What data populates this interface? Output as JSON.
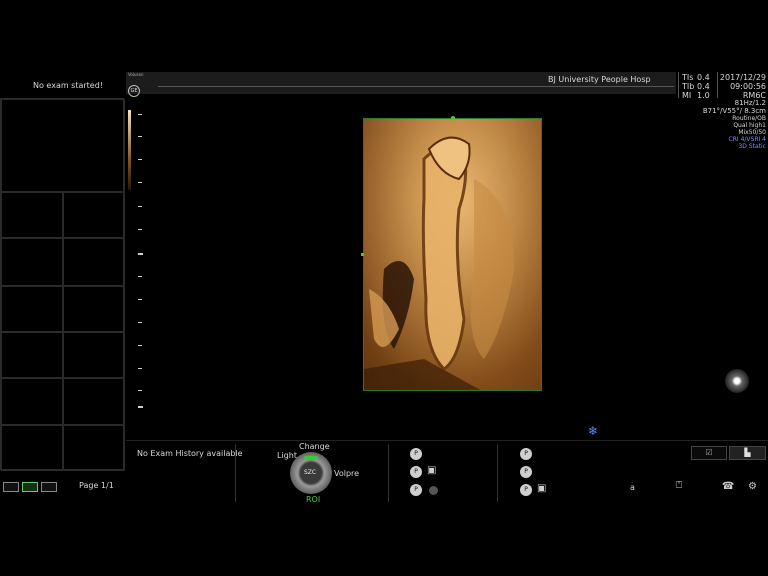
{
  "left_panel": {
    "status": "No exam started!",
    "history": "No Exam History available",
    "page": "Page 1/1"
  },
  "header": {
    "logo_small": "Voluson",
    "hospital": "BJ University People Hosp",
    "tis": "TIs",
    "tis_value": "0.4",
    "tib": "TIb",
    "tib_value": "0.4",
    "mi": "MI",
    "mi_value": "1.0",
    "date": "2017/12/29",
    "time": "09:00:56",
    "probe": "RM6C"
  },
  "right_info": [
    "81Hz/1.2",
    "B71°/V55°/ 8.3cm",
    "Routine/OB",
    "Qual high1",
    "Mix50/50",
    "CRI 4/VSRI 4",
    "3D Static"
  ],
  "controls": {
    "change": "Change",
    "light": "Light",
    "volpre": "Volpre",
    "knob": "SZC",
    "roi": "ROI"
  },
  "bottom_right": {
    "letter": "a"
  }
}
